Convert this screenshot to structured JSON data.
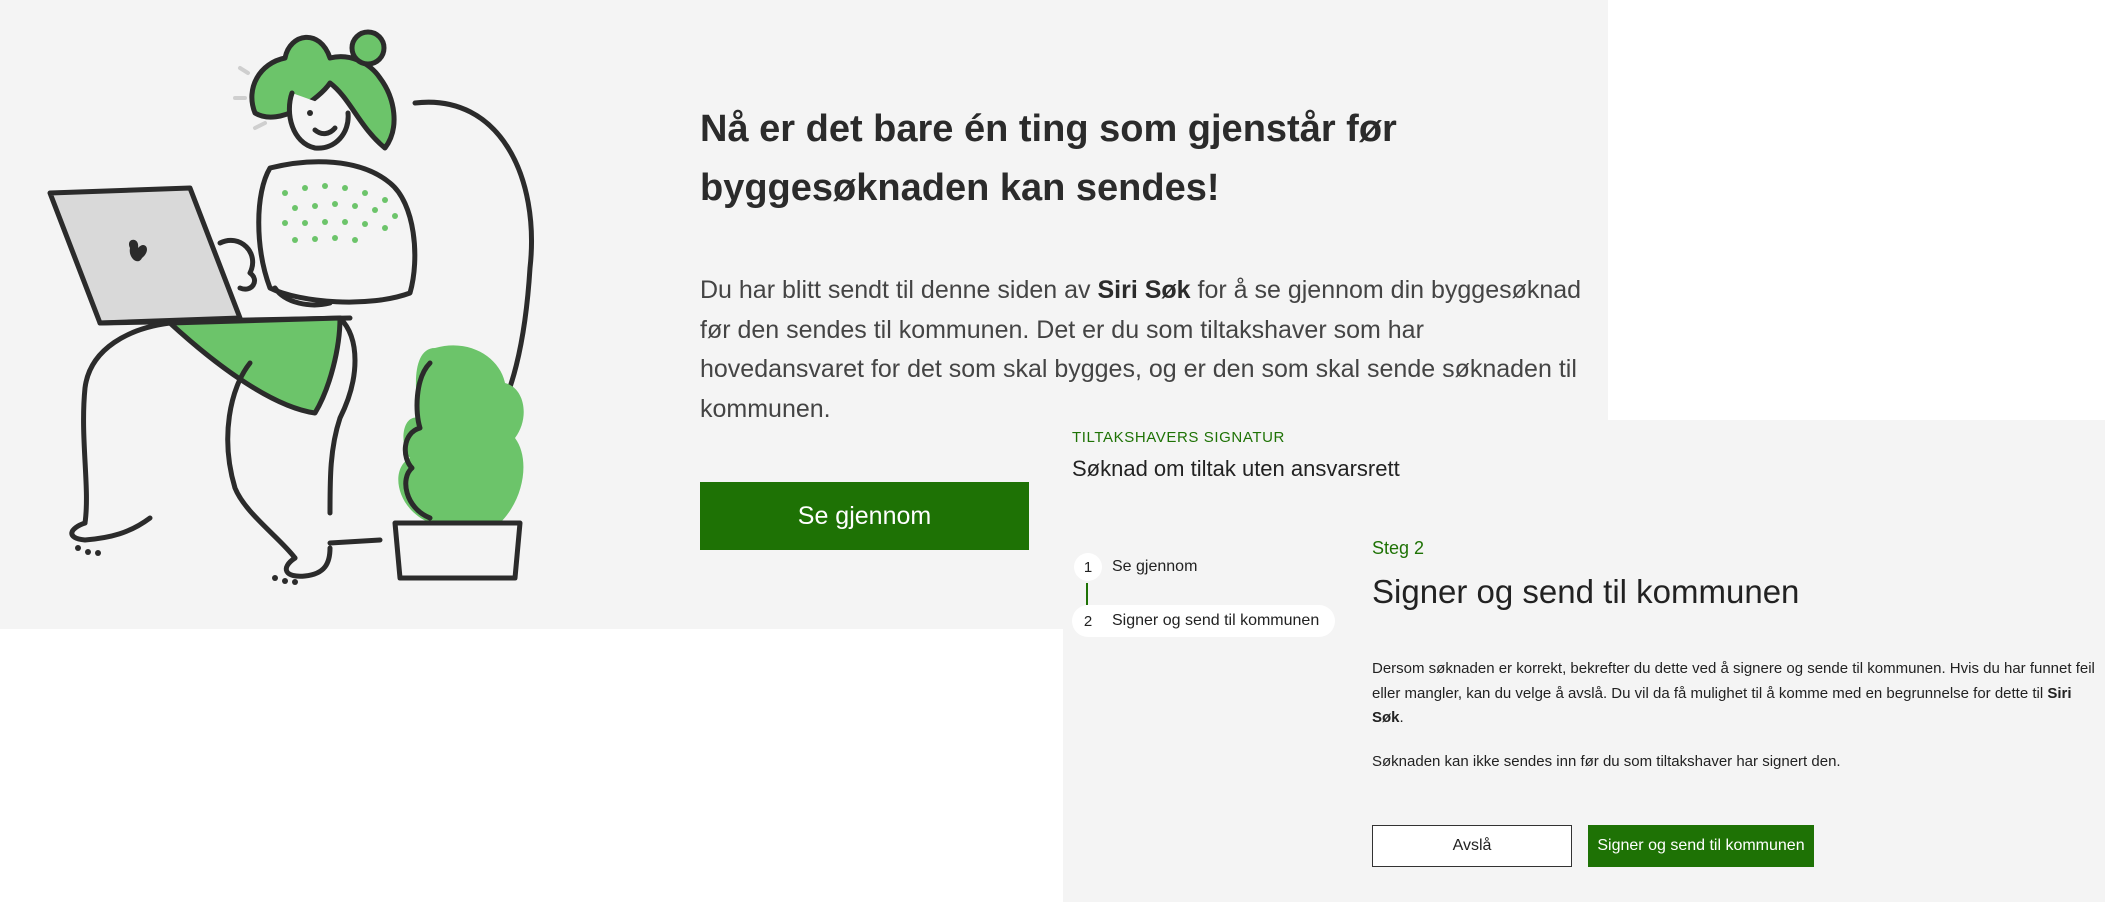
{
  "hero": {
    "title": "Nå er det bare én ting som gjenstår før byggesøknaden kan sendes!",
    "body_before": "Du har blitt sendt til denne siden av ",
    "sender_name": "Siri Søk",
    "body_after": " for å se gjennom din byggesøknad før den sendes til kommunen. Det er du som tiltakshaver som har hovedansvaret for det som skal bygges, og er den som skal sende søknaden til kommunen.",
    "button_label": "Se gjennom",
    "illustration_icon": "person-with-laptop-illustration"
  },
  "panel": {
    "eyebrow": "TILTAKSHAVERS SIGNATUR",
    "subtitle": "Søknad om tiltak uten ansvarsrett",
    "steps": [
      {
        "number": "1",
        "label": "Se gjennom"
      },
      {
        "number": "2",
        "label": "Signer og send til kommunen"
      }
    ],
    "active_step": {
      "kicker": "Steg 2",
      "title": "Signer og send til kommunen",
      "text_before": "Dersom søknaden er korrekt, bekrefter du dette ved å signere og sende til kommunen. Hvis du har funnet feil eller mangler, kan du velge å avslå. Du vil da få mulighet til å komme med en begrunnelse for dette til ",
      "sender_name": "Siri Søk",
      "text_after": ".",
      "note": "Søknaden kan ikke sendes inn før du som tiltakshaver har signert den."
    },
    "buttons": {
      "decline": "Avslå",
      "sign": "Signer og send til kommunen"
    }
  },
  "colors": {
    "brand_green": "#1e7205",
    "illustration_green": "#6cc46a",
    "panel_background": "#f4f4f4"
  }
}
